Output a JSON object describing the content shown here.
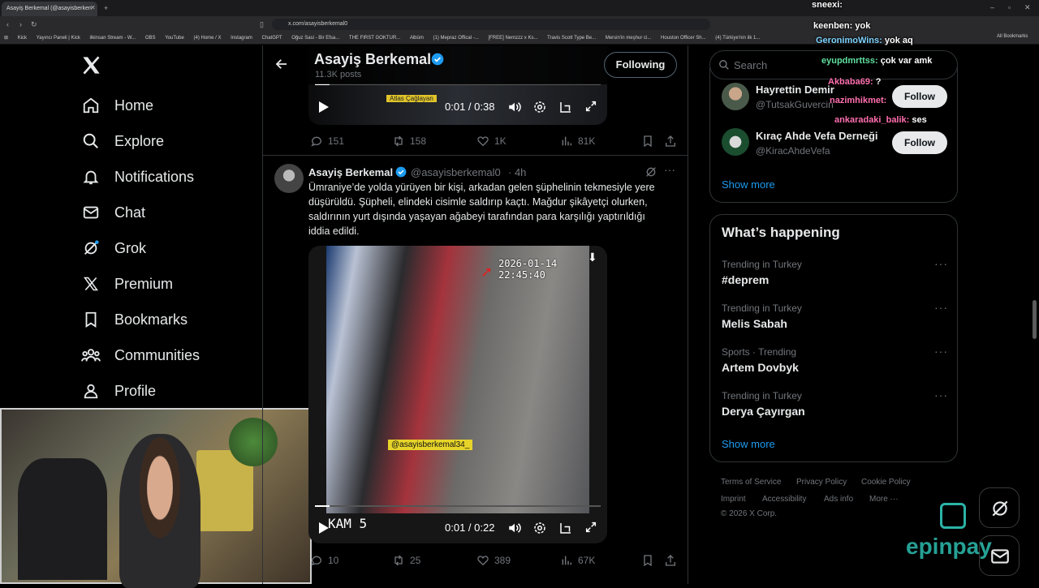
{
  "browser": {
    "tab_title": "Asayiş Berkemal (@asayisberken",
    "url": "x.com/asayisberkemal0",
    "bookmarks": [
      "Kick",
      "Yayıncı Paneli | Kick",
      "ilkinsan Stream - W...",
      "OBS",
      "YouTube",
      "(4) Home / X",
      "Instagram",
      "ChatGPT",
      "Oğuz Sasi - Bir Efsa...",
      "THE FIRST GOKTUR...",
      "Albüm",
      "(1) Mepraz Offical -...",
      "[FREE] Nemzzz x Ks...",
      "Travis Scott Type Be...",
      "Mersin'in meşhur ci...",
      "Houston Officer Sh...",
      "(4) Türkiye'nin ilk 1..."
    ],
    "all_bookmarks": "All Bookmarks"
  },
  "nav": {
    "items": [
      {
        "label": "Home",
        "icon": "home-icon"
      },
      {
        "label": "Explore",
        "icon": "search-icon"
      },
      {
        "label": "Notifications",
        "icon": "bell-icon"
      },
      {
        "label": "Chat",
        "icon": "mail-icon"
      },
      {
        "label": "Grok",
        "icon": "grok-icon"
      },
      {
        "label": "Premium",
        "icon": "x-icon"
      },
      {
        "label": "Bookmarks",
        "icon": "bookmark-icon"
      },
      {
        "label": "Communities",
        "icon": "people-icon"
      },
      {
        "label": "Profile",
        "icon": "person-icon"
      }
    ]
  },
  "profile_header": {
    "name": "Asayiş Berkemal",
    "posts": "11.3K posts",
    "following_label": "Following"
  },
  "top_video": {
    "watermark": "Atlas Çağlayan",
    "time": "0:01 / 0:38",
    "replies": "151",
    "reposts": "158",
    "likes": "1K",
    "views": "81K"
  },
  "tweet": {
    "name": "Asayiş Berkemal",
    "handle": "@asayisberkemal0",
    "time": "· 4h",
    "text": "Ümraniye’de yolda yürüyen bir kişi, arkadan gelen şüphelinin tekmesiyle yere düşürüldü. Şüpheli, elindeki cisimle saldırıp kaçtı. Mağdur şikâyetçi olurken, saldırının yurt dışında yaşayan ağabeyi tarafından para karşılığı yaptırıldığı iddia edildi.",
    "video_timestamp": "2026-01-14 22:45:40",
    "video_watermark": "@asayisberkemal34_",
    "video_cam": "KAM 5",
    "video_time": "0:01 / 0:22",
    "video_progress": 0.05,
    "replies": "10",
    "reposts": "25",
    "likes": "389",
    "views": "67K"
  },
  "search": {
    "placeholder": "Search"
  },
  "who_to_follow": {
    "users": [
      {
        "name": "Hayrettin Demir",
        "handle": "@TutsakGuvercin",
        "button": "Follow"
      },
      {
        "name": "Kıraç Ahde Vefa Derneği",
        "handle": "@KiracAhdeVefa",
        "button": "Follow"
      }
    ],
    "show_more": "Show more"
  },
  "happening": {
    "title": "What’s happening",
    "trends": [
      {
        "meta": "Trending in Turkey",
        "name": "#deprem"
      },
      {
        "meta": "Trending in Turkey",
        "name": "Melis Sabah"
      },
      {
        "meta": "Sports · Trending",
        "name": "Artem Dovbyk"
      },
      {
        "meta": "Trending in Turkey",
        "name": "Derya Çayırgan"
      }
    ],
    "show_more": "Show more"
  },
  "footer": {
    "links": [
      "Terms of Service",
      "Privacy Policy",
      "Cookie Policy",
      "Imprint",
      "Accessibility",
      "Ads info",
      "More ···"
    ],
    "copyright": "© 2026 X Corp."
  },
  "stream_chat": [
    {
      "user": "sneexi:",
      "msg": "",
      "color": "#ffffff"
    },
    {
      "user": "keenben:",
      "msg": "yok",
      "color": "#ffffff"
    },
    {
      "user": "GeronimoWins:",
      "msg": "yok aq",
      "color": "#7fd4ff"
    },
    {
      "user": "eyupdmrttss:",
      "msg": "çok var amk",
      "color": "#5fe0a0"
    },
    {
      "user": "Akbaba69:",
      "msg": "?",
      "color": "#ff6fae"
    },
    {
      "user": "nazimhikmet:",
      "msg": "",
      "color": "#ff6fae"
    },
    {
      "user": "ankaradaki_balik:",
      "msg": "ses",
      "color": "#ff6fae"
    }
  ],
  "sponsor": {
    "name": "epinpay"
  },
  "colors": {
    "accent": "#1d9bf0",
    "background": "#000000",
    "border": "#2f3336",
    "muted": "#71767b",
    "sponsor": "#2bb3a6"
  }
}
